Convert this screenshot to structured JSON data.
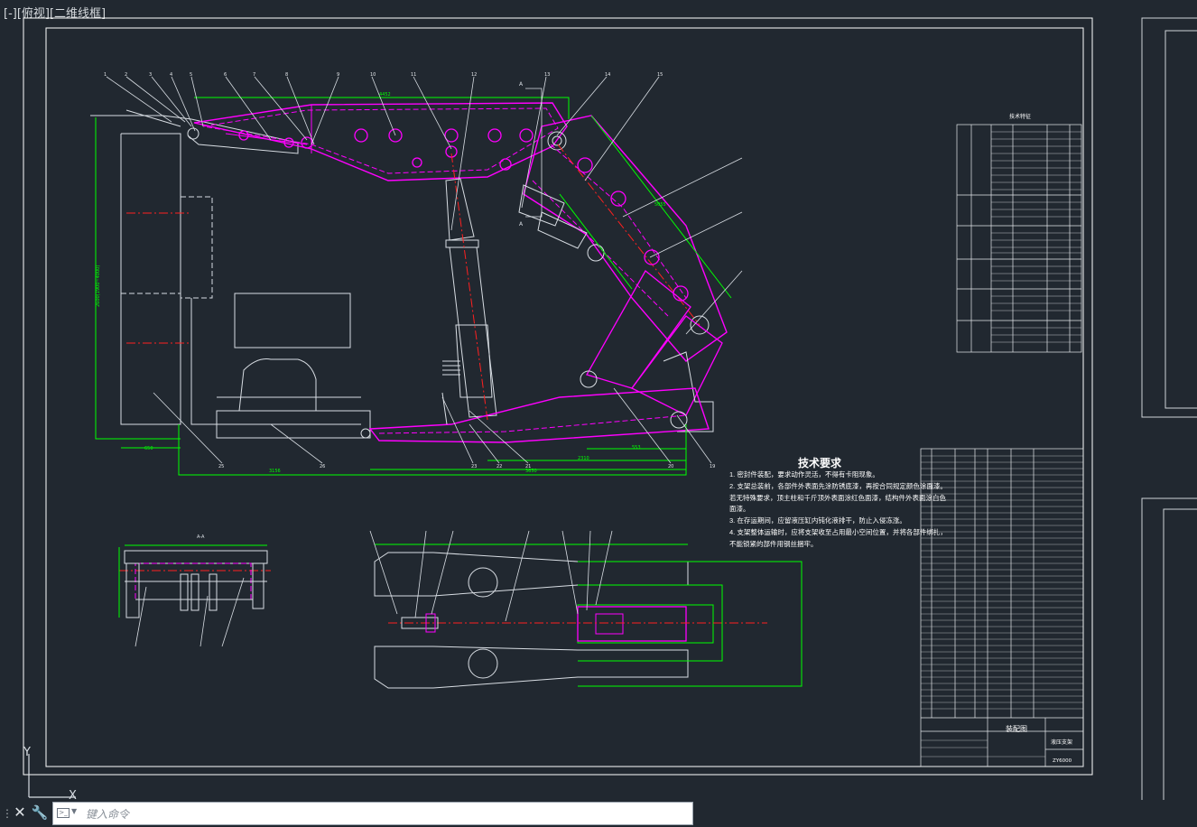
{
  "viewport": {
    "label": "[-][俯视][二维线框]"
  },
  "drawing": {
    "balloon_numbers_top": [
      "1",
      "2",
      "3",
      "4",
      "5",
      "6",
      "7",
      "8",
      "9",
      "10",
      "11",
      "12",
      "13",
      "14",
      "15"
    ],
    "balloon_numbers_bottom": [
      "25",
      "26",
      "23",
      "22",
      "21",
      "20",
      "19"
    ],
    "section_label": "A-A",
    "section_marker": "A",
    "technical_table_title": "技术特征",
    "parts_table_title": "装配图",
    "drawing_code": "ZY6000",
    "drawing_name": "液压支架"
  },
  "notes": {
    "title": "技术要求",
    "lines": [
      "1. 密封件装配，要求动作灵活，不得有卡阻现象。",
      "2. 支架总装前，各部件外表面先涂防锈底漆，再按合同规定颜色涂面漆。",
      "若无特殊要求，顶主柱和千斤顶外表面涂红色面漆，结构件外表面涂白色",
      "面漆。",
      "3. 在存运期间，应留液压缸内钝化液排干，防止入侵冻涨。",
      "4. 支架整体运输时，应将支架收至占用最小空间位置，并将各部件绑扎，",
      "不能锁紧的部件用钢丝捆牢。"
    ]
  },
  "command_line": {
    "placeholder": "键入命令",
    "close_label": "✕",
    "settings_label": "🔧"
  },
  "ucs": {
    "y_label": "Y",
    "x_label": "X"
  },
  "colors": {
    "background": "#212830",
    "frame": "#ffffff",
    "magenta": "#ff00ff",
    "green": "#00ff00",
    "red": "#ff2020"
  }
}
